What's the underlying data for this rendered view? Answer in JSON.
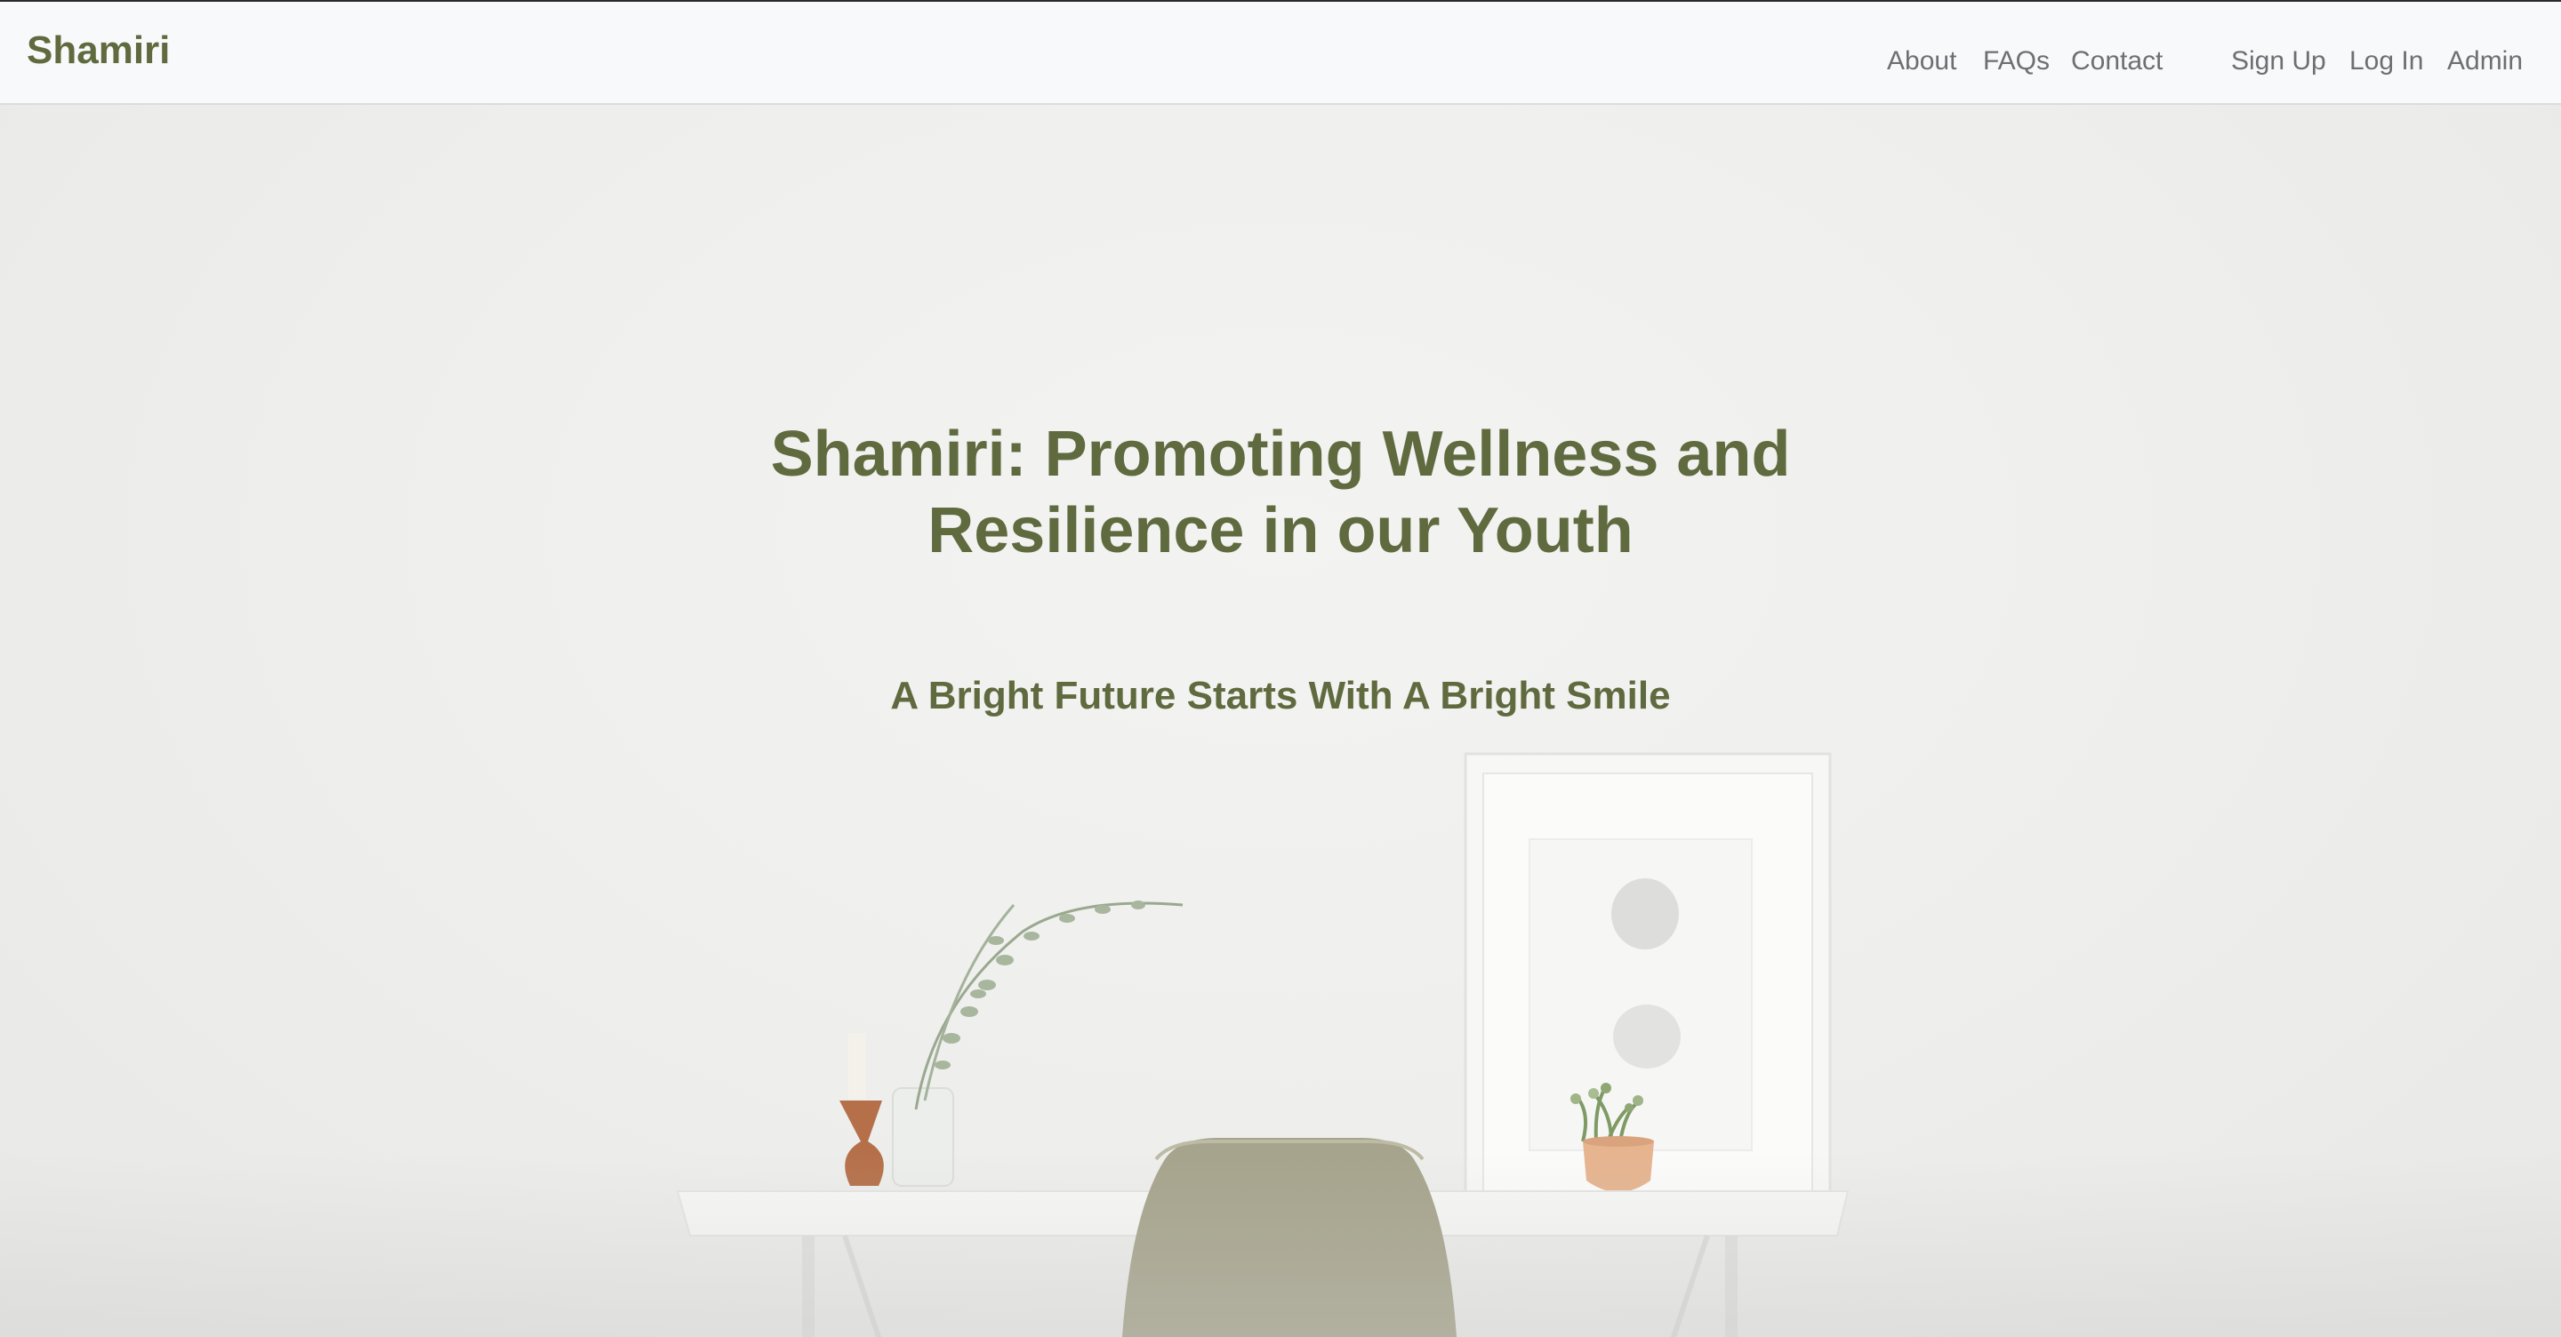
{
  "navbar": {
    "brand": "Shamiri",
    "links": {
      "about": "About",
      "faqs": "FAQs",
      "contact": "Contact",
      "signup": "Sign Up",
      "login": "Log In",
      "admin": "Admin"
    }
  },
  "hero": {
    "title_line1": "Shamiri: Promoting Wellness and",
    "title_line2": "Resilience in our Youth",
    "subtitle": "A Bright Future Starts With A Bright Smile"
  },
  "colors": {
    "brand": "#5f6a3f",
    "nav_text": "#6c6f73",
    "navbar_bg": "#f8f9fa",
    "hero_bg": "#eeeeec"
  },
  "background_image": {
    "objects": [
      "framed-art",
      "potted-succulent",
      "candle-holder",
      "eucalyptus-vase",
      "desk",
      "chair"
    ]
  }
}
